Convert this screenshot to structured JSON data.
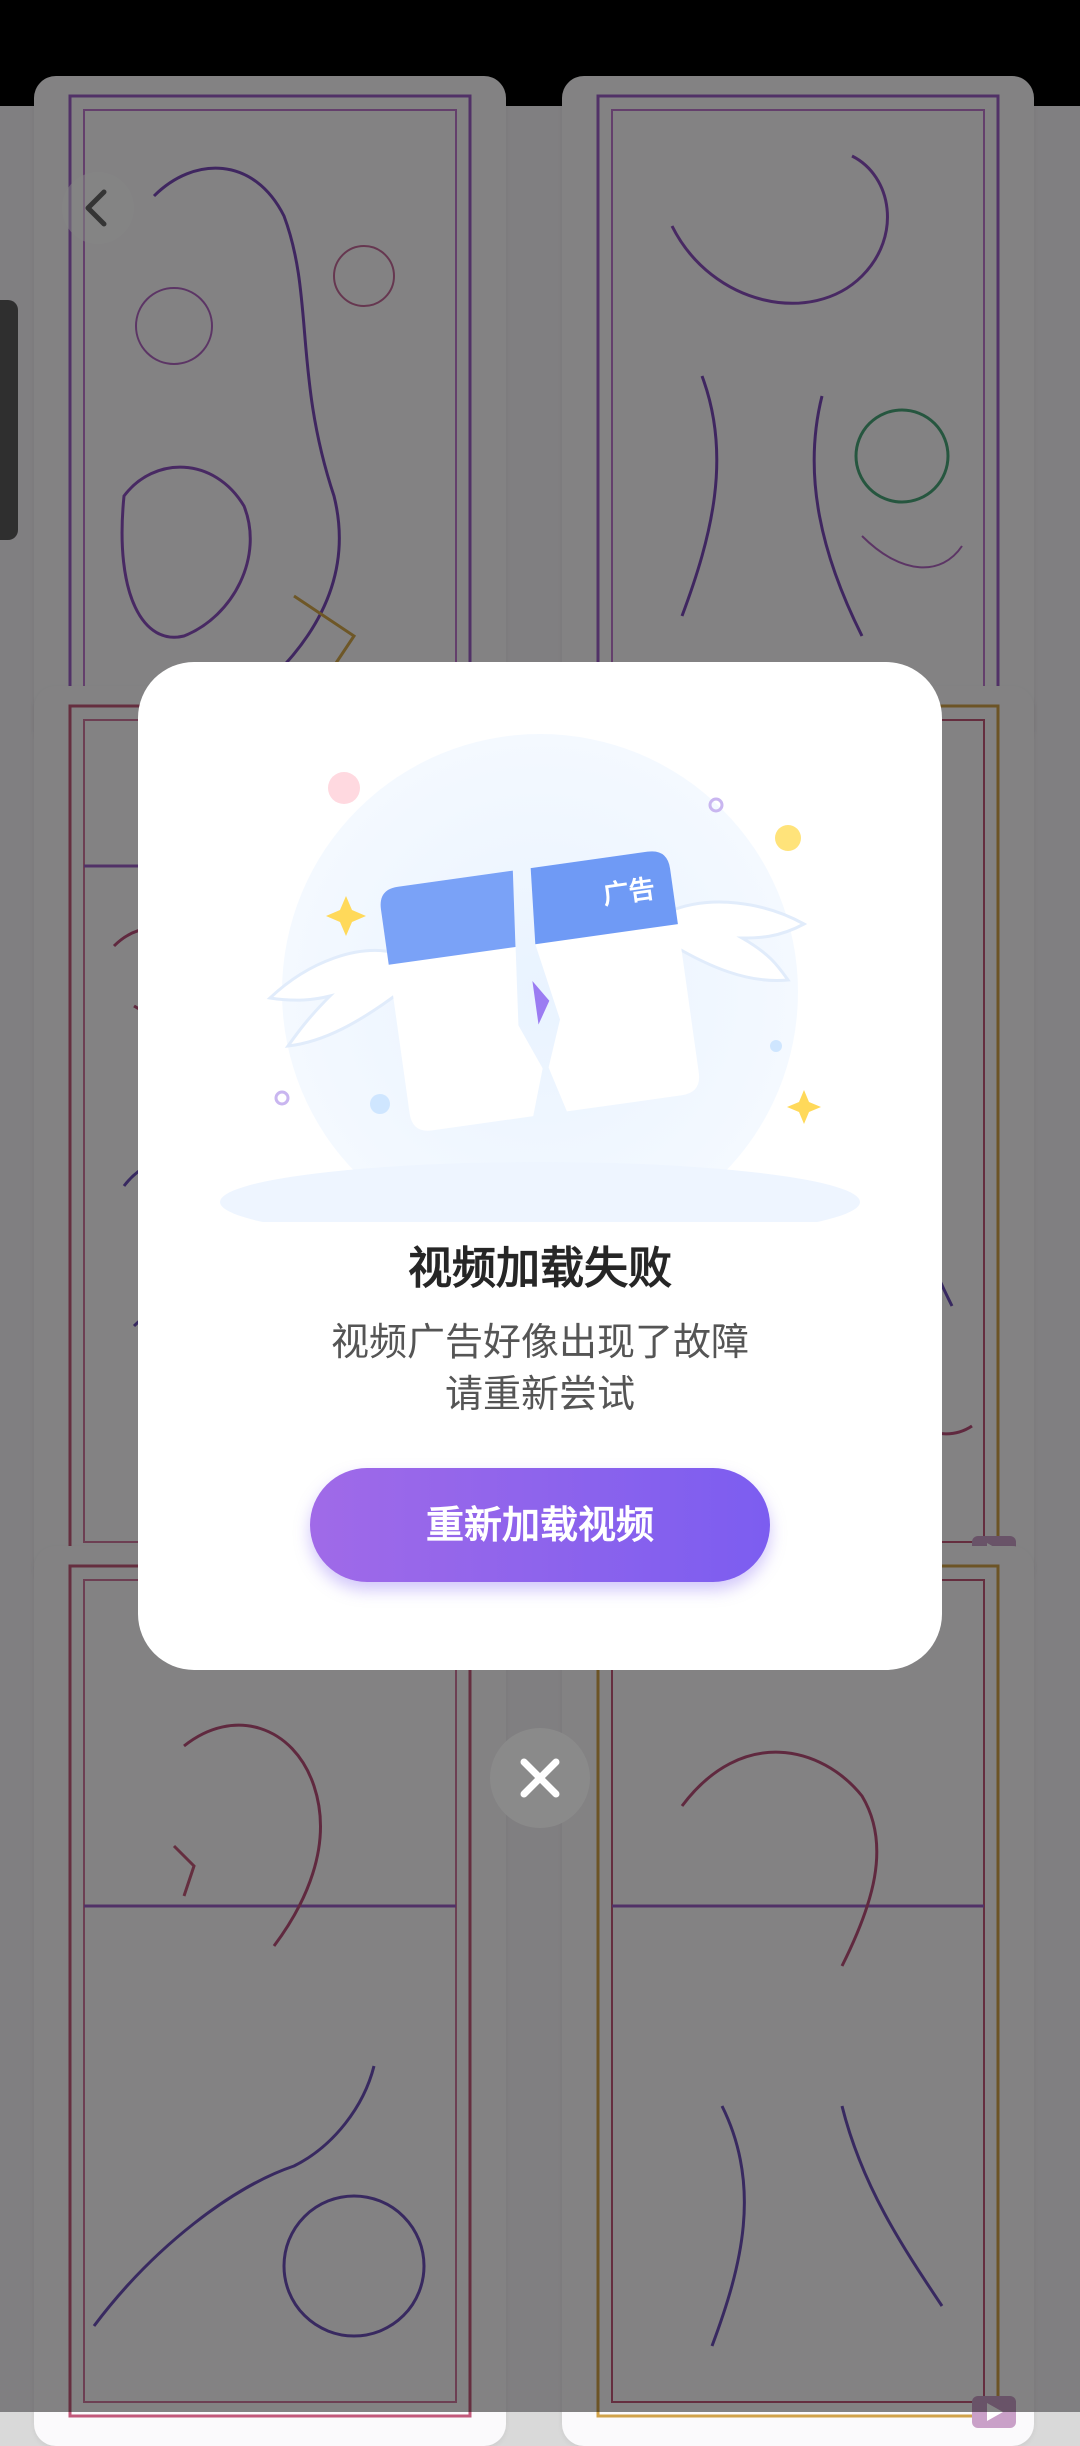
{
  "dialog": {
    "title": "视频加载失败",
    "message_line1": "视频广告好像出现了故障",
    "message_line2": "请重新尝试",
    "reload_button": "重新加载视频",
    "ad_tag": "广告"
  },
  "icons": {
    "back": "chevron-left-icon",
    "close": "close-icon",
    "play": "video-play-icon"
  },
  "colors": {
    "button_start": "#a06ae8",
    "button_end": "#7c5df0",
    "ad_header": "#7aa2f7"
  }
}
